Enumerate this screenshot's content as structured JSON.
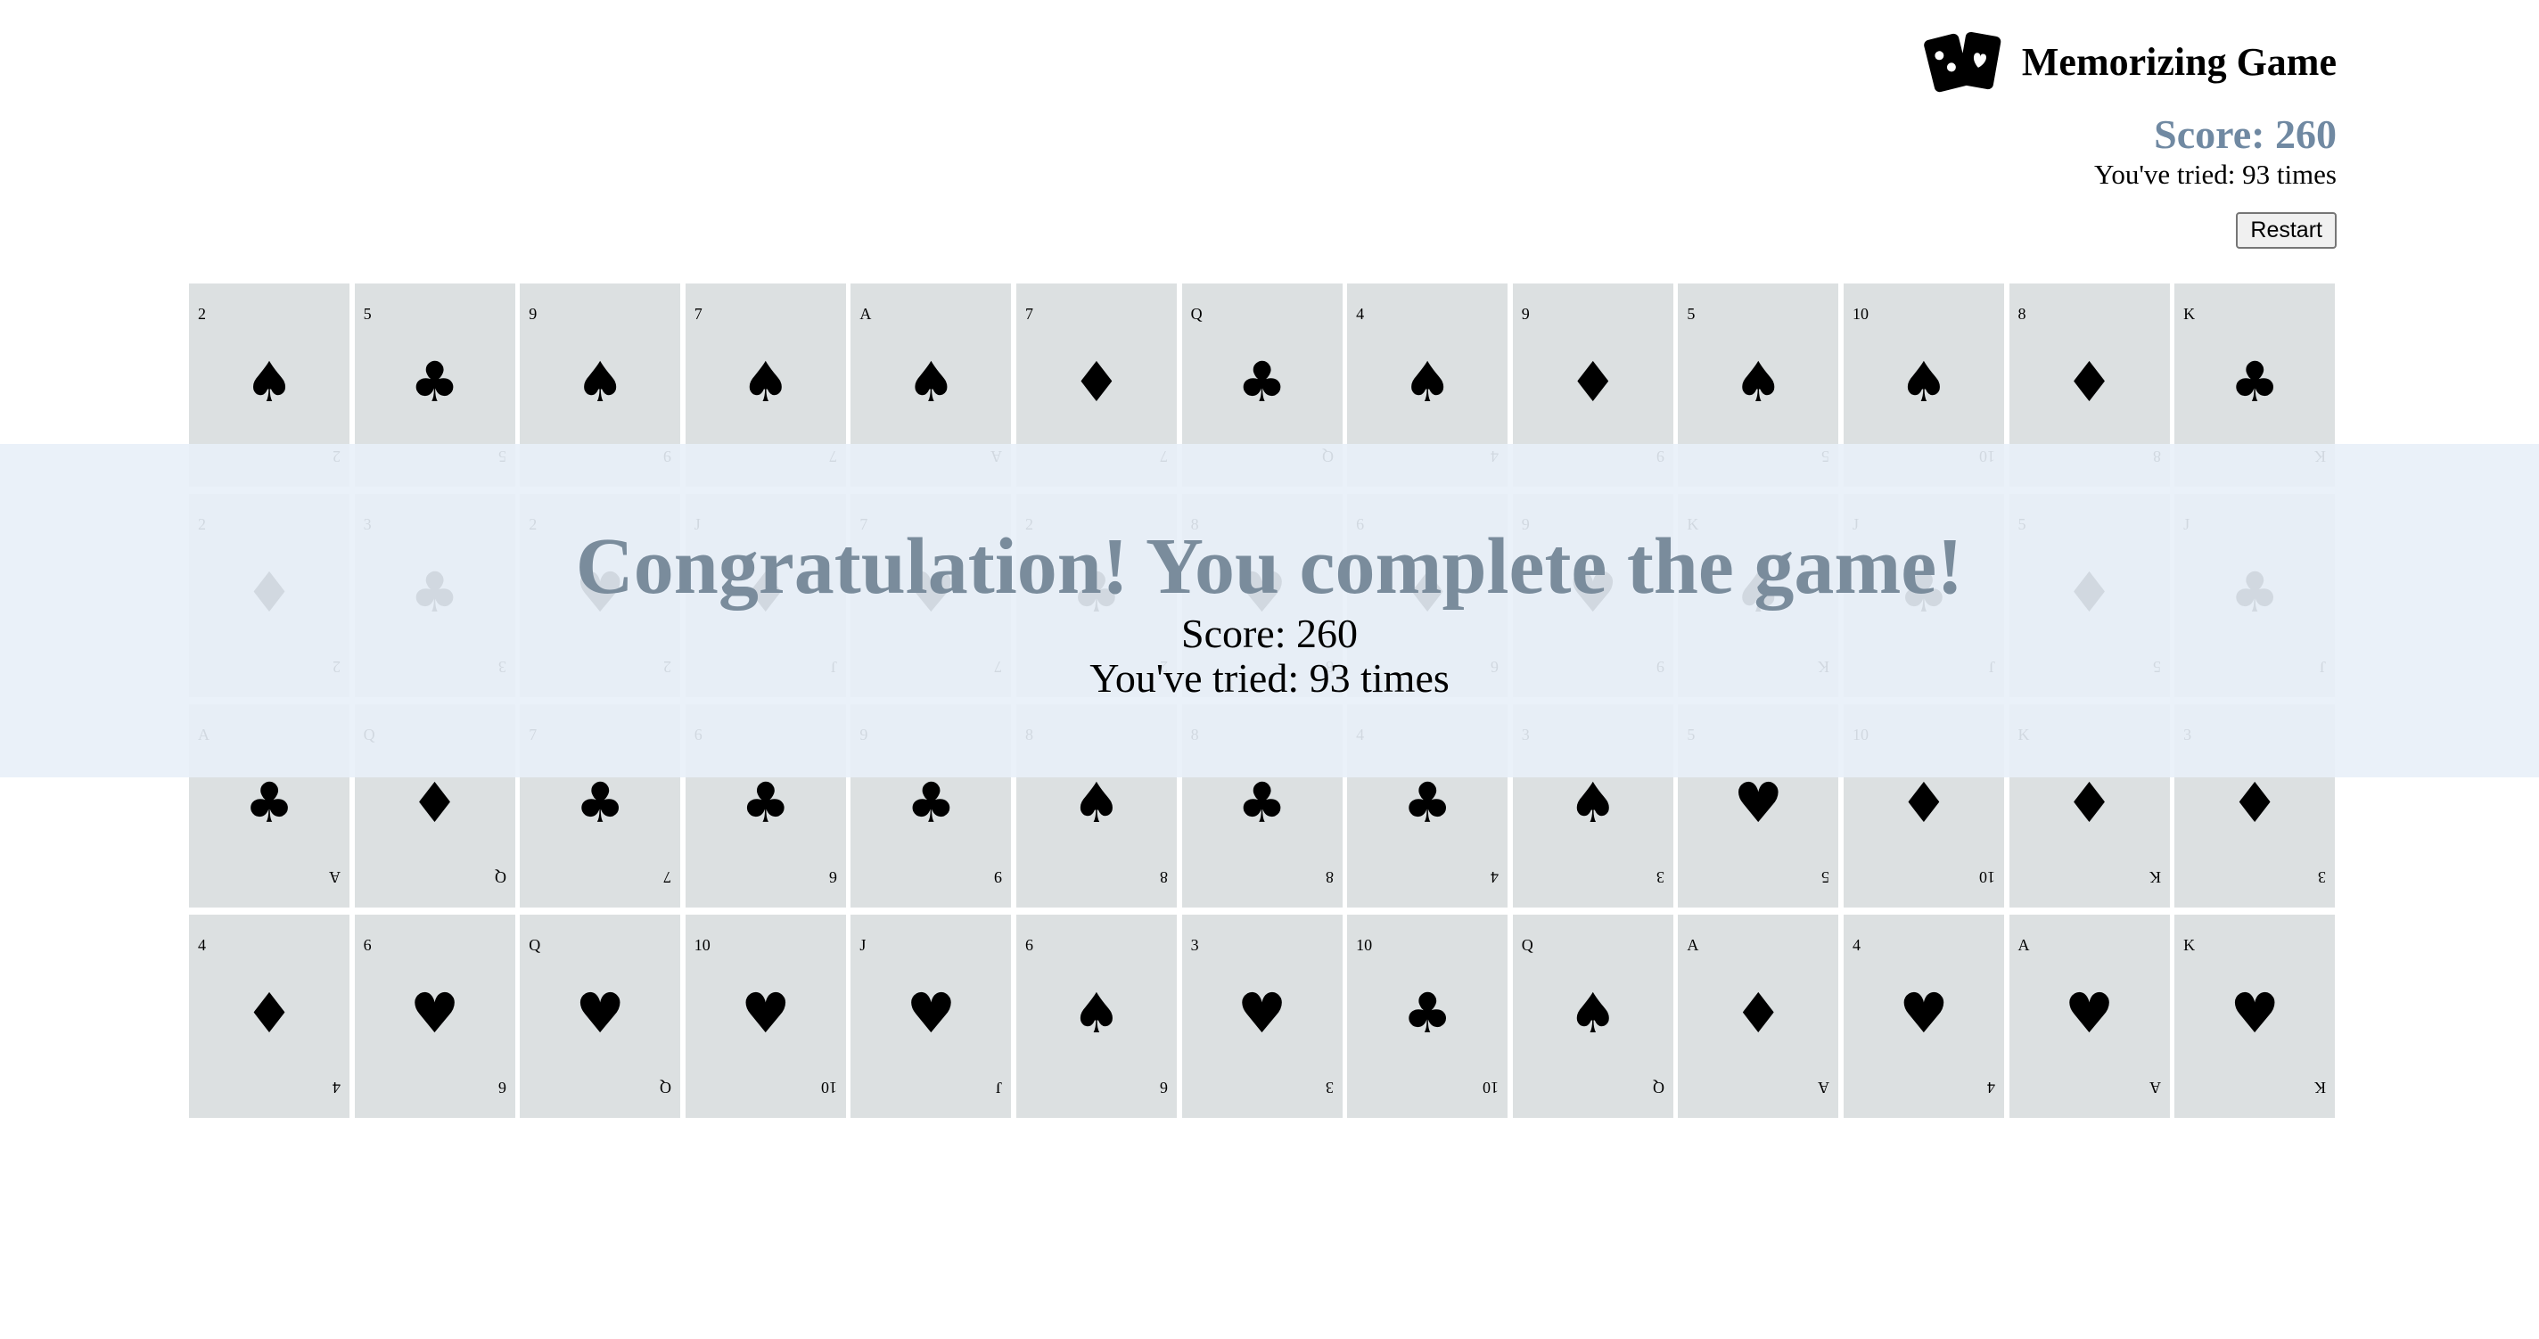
{
  "header": {
    "title": "Memorizing Game",
    "logo_icon": "playing-cards-icon"
  },
  "status": {
    "score_text": "Score: 260",
    "tries_text": "You've tried: 93 times"
  },
  "controls": {
    "restart_label": "Restart"
  },
  "overlay": {
    "message": "Congratulation! You complete the game!",
    "score_text": "Score: 260",
    "tries_text": "You've tried: 93 times"
  },
  "colors": {
    "score_accent": "#7089a2",
    "card_background": "#dce0e1",
    "overlay_background": "#e8f0f8"
  },
  "cards": [
    {
      "rank": "2",
      "suit": "♠"
    },
    {
      "rank": "5",
      "suit": "♣"
    },
    {
      "rank": "9",
      "suit": "♠"
    },
    {
      "rank": "7",
      "suit": "♠"
    },
    {
      "rank": "A",
      "suit": "♠"
    },
    {
      "rank": "7",
      "suit": "♦"
    },
    {
      "rank": "Q",
      "suit": "♣"
    },
    {
      "rank": "4",
      "suit": "♠"
    },
    {
      "rank": "9",
      "suit": "♦"
    },
    {
      "rank": "5",
      "suit": "♠"
    },
    {
      "rank": "10",
      "suit": "♠"
    },
    {
      "rank": "8",
      "suit": "♦"
    },
    {
      "rank": "K",
      "suit": "♣"
    },
    {
      "rank": "2",
      "suit": "♦"
    },
    {
      "rank": "3",
      "suit": "♣"
    },
    {
      "rank": "2",
      "suit": "♥"
    },
    {
      "rank": "J",
      "suit": "♦"
    },
    {
      "rank": "7",
      "suit": "♥"
    },
    {
      "rank": "2",
      "suit": "♣"
    },
    {
      "rank": "8",
      "suit": "♥"
    },
    {
      "rank": "6",
      "suit": "♦"
    },
    {
      "rank": "9",
      "suit": "♥"
    },
    {
      "rank": "K",
      "suit": "♠"
    },
    {
      "rank": "J",
      "suit": "♣"
    },
    {
      "rank": "5",
      "suit": "♦"
    },
    {
      "rank": "J",
      "suit": "♣"
    },
    {
      "rank": "A",
      "suit": "♣"
    },
    {
      "rank": "Q",
      "suit": "♦"
    },
    {
      "rank": "7",
      "suit": "♣"
    },
    {
      "rank": "6",
      "suit": "♣"
    },
    {
      "rank": "9",
      "suit": "♣"
    },
    {
      "rank": "8",
      "suit": "♠"
    },
    {
      "rank": "8",
      "suit": "♣"
    },
    {
      "rank": "4",
      "suit": "♣"
    },
    {
      "rank": "3",
      "suit": "♠"
    },
    {
      "rank": "5",
      "suit": "♥"
    },
    {
      "rank": "10",
      "suit": "♦"
    },
    {
      "rank": "K",
      "suit": "♦"
    },
    {
      "rank": "3",
      "suit": "♦"
    },
    {
      "rank": "4",
      "suit": "♦"
    },
    {
      "rank": "6",
      "suit": "♥"
    },
    {
      "rank": "Q",
      "suit": "♥"
    },
    {
      "rank": "10",
      "suit": "♥"
    },
    {
      "rank": "J",
      "suit": "♥"
    },
    {
      "rank": "6",
      "suit": "♠"
    },
    {
      "rank": "3",
      "suit": "♥"
    },
    {
      "rank": "10",
      "suit": "♣"
    },
    {
      "rank": "Q",
      "suit": "♠"
    },
    {
      "rank": "A",
      "suit": "♦"
    },
    {
      "rank": "4",
      "suit": "♥"
    },
    {
      "rank": "A",
      "suit": "♥"
    },
    {
      "rank": "K",
      "suit": "♥"
    }
  ]
}
